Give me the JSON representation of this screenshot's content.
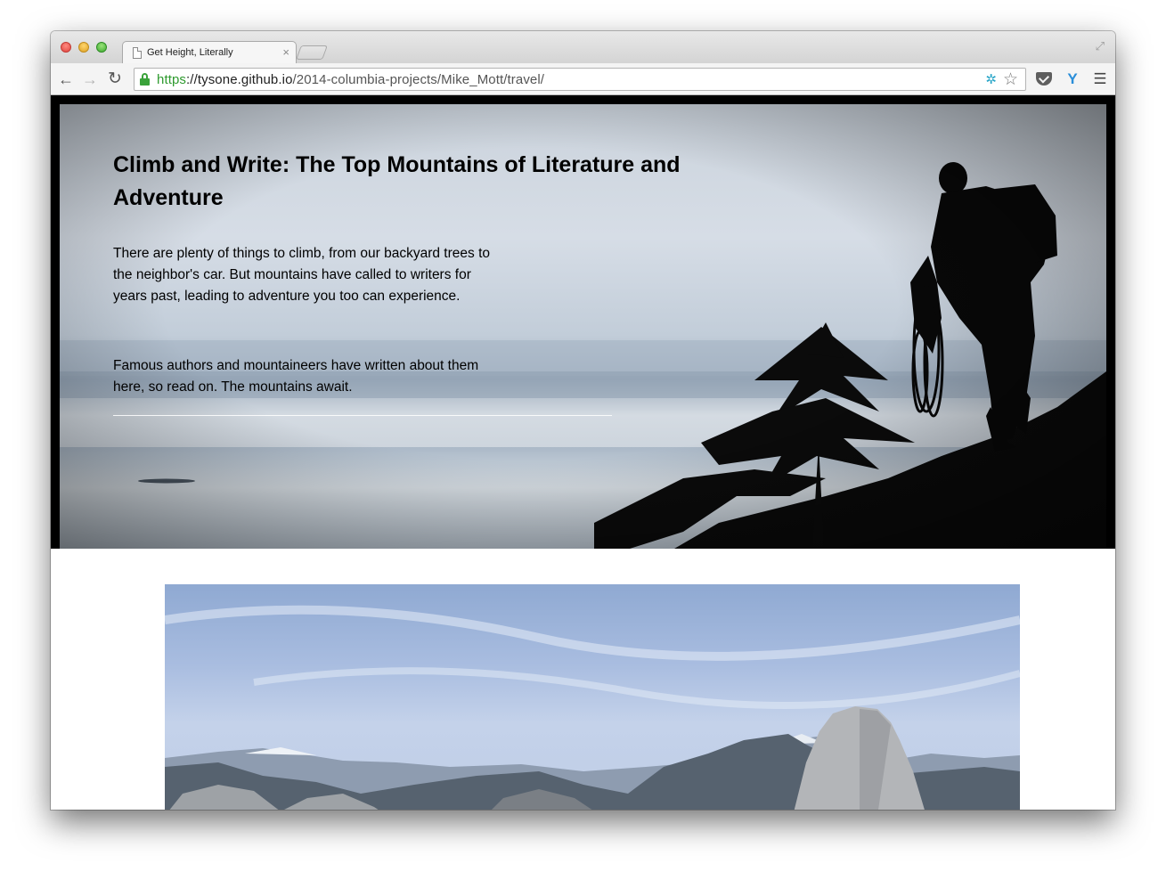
{
  "browser": {
    "tab": {
      "title": "Get Height, Literally",
      "close_glyph": "×"
    },
    "url": {
      "scheme": "https",
      "separator": "://",
      "host": "tysone.github.io",
      "path": "/2014-columbia-projects/Mike_Mott/travel/"
    },
    "toolbar_icons": [
      "back-icon",
      "forward-icon",
      "reload-icon",
      "lock-icon",
      "extension-icon",
      "star-icon",
      "pocket-icon",
      "ghostery-icon",
      "menu-icon"
    ],
    "colors": {
      "secure_green": "#2e9a2e"
    }
  },
  "hero": {
    "title": "Climb and Write: The Top Mountains of Literature and Adventure",
    "paragraph_1": "There are plenty of things to climb, from our backyard trees to the neighbor's car. But mountains have called to writers for years past, leading to adventure you too can experience.",
    "paragraph_2": "Famous authors and mountaineers have written about them here, so read on. The mountains await."
  }
}
